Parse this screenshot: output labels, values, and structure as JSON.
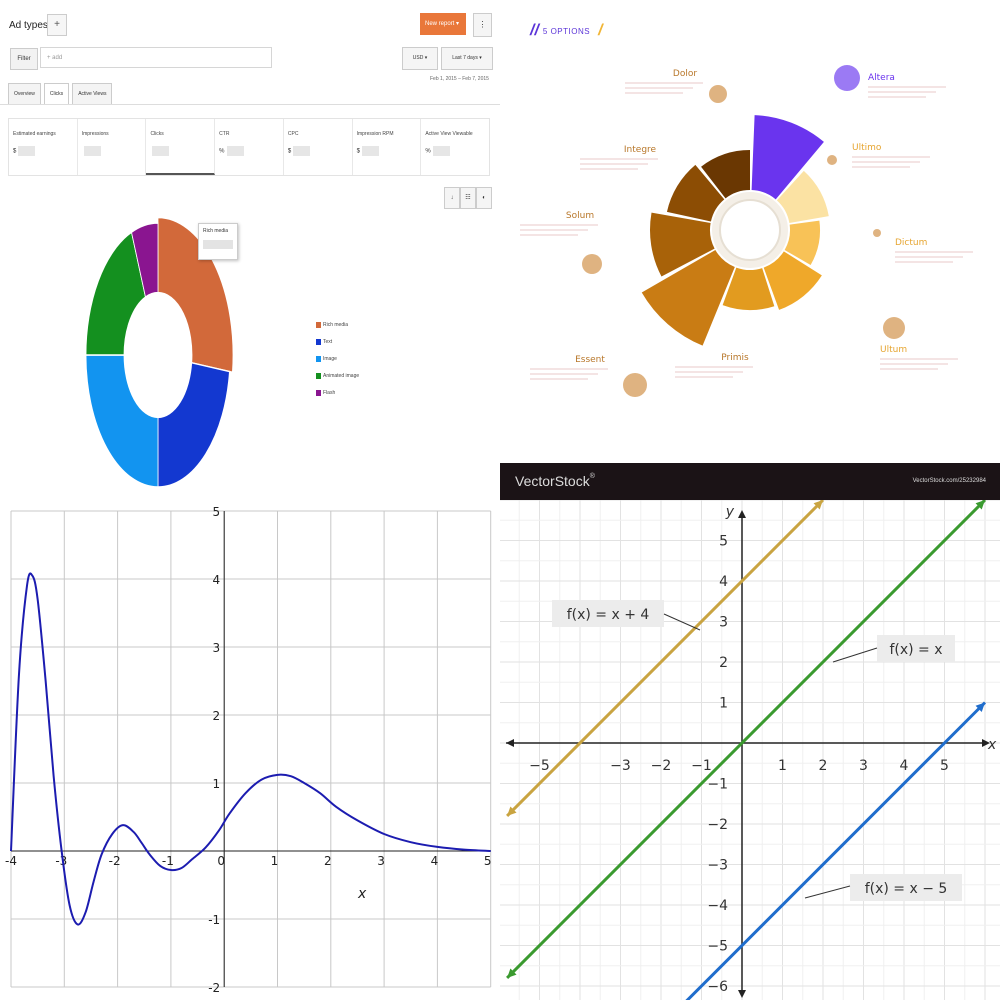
{
  "dashboard": {
    "title": "Ad types",
    "title_arrow": "▾",
    "add_label": "+",
    "new_report_label": "New report ▾",
    "more_label": "⋮",
    "filter_label": "Filter",
    "filter_placeholder": "+ add",
    "currency_label": "USD ▾",
    "range_label": "Last 7 days ▾",
    "date_range": "Feb 1, 2015 – Feb 7, 2015",
    "tabs": [
      {
        "label": "Overview"
      },
      {
        "label": "Clicks"
      },
      {
        "label": "Active Views"
      }
    ],
    "metrics": [
      {
        "label": "Estimated earnings",
        "prefix": "$"
      },
      {
        "label": "Impressions",
        "prefix": ""
      },
      {
        "label": "Clicks",
        "prefix": ""
      },
      {
        "label": "CTR",
        "prefix": "%"
      },
      {
        "label": "CPC",
        "prefix": "$"
      },
      {
        "label": "Impression RPM",
        "prefix": "$"
      },
      {
        "label": "Active View Viewable",
        "prefix": "%"
      }
    ],
    "tooltip_label": "Rich media",
    "view_controls": [
      "↓",
      "☷",
      "◐"
    ]
  },
  "chart_data": [
    {
      "type": "pie",
      "categories": [
        "Rich media",
        "Text",
        "Image",
        "Animated image",
        "Flash"
      ],
      "values": [
        27,
        23,
        25,
        19,
        6
      ],
      "colors": [
        "#d2693a",
        "#1338d0",
        "#1294f0",
        "#14901f",
        "#8a1590"
      ],
      "legend_position": "right"
    },
    {
      "type": "pie",
      "header": "5 OPTIONS",
      "categories": [
        "Altera",
        "Ultimo",
        "Dictum",
        "Ultum",
        "Primis",
        "Essent",
        "Solum",
        "Integre",
        "Dolor"
      ],
      "values": [
        1,
        1,
        1,
        1,
        1,
        1,
        1,
        1,
        1
      ],
      "colors": [
        "#6a34ee",
        "#fbe2a3",
        "#f8c257",
        "#efa82a",
        "#e29b1f",
        "#c97c14",
        "#a86209",
        "#8c4d04",
        "#6a3702"
      ],
      "brand": "VectorStock",
      "brand_mark": "®",
      "url": "VectorStock.com/25232984"
    },
    {
      "type": "line",
      "xlabel": "x",
      "ylabel": "",
      "xlim": [
        -4,
        5
      ],
      "ylim": [
        -2,
        5
      ],
      "grid": true,
      "x_ticks": [
        "-4",
        "-3",
        "-2",
        "-1",
        "0",
        "1",
        "2",
        "3",
        "4",
        "5"
      ],
      "y_ticks": [
        "5",
        "4",
        "3",
        "2",
        "1",
        "-1",
        "-2"
      ],
      "series": [
        {
          "color": "#1c1cb0",
          "x": [
            -4,
            -3.85,
            -3.7,
            -3.6,
            -3.5,
            -3.35,
            -3.2,
            -3.05,
            -2.9,
            -2.75,
            -2.6,
            -2.45,
            -2.3,
            -2.1,
            -1.9,
            -1.7,
            -1.55,
            -1.4,
            -1.2,
            -1.0,
            -0.8,
            -0.6,
            -0.35,
            -0.1,
            0.1,
            0.4,
            0.7,
            1.0,
            1.25,
            1.5,
            1.8,
            2.1,
            2.5,
            3.0,
            3.5,
            4.0,
            4.5,
            5.0
          ],
          "y": [
            0.0,
            2.6,
            3.9,
            4.05,
            3.7,
            2.5,
            1.1,
            0.0,
            -0.8,
            -1.08,
            -0.9,
            -0.45,
            -0.05,
            0.25,
            0.38,
            0.28,
            0.12,
            -0.05,
            -0.22,
            -0.28,
            -0.25,
            -0.12,
            0.05,
            0.3,
            0.55,
            0.85,
            1.05,
            1.12,
            1.1,
            1.0,
            0.85,
            0.65,
            0.45,
            0.25,
            0.13,
            0.06,
            0.02,
            0.0
          ]
        }
      ]
    },
    {
      "type": "line",
      "xlabel": "x",
      "ylabel": "y",
      "xlim": [
        -5.8,
        6
      ],
      "ylim": [
        -6.8,
        6
      ],
      "grid": true,
      "x_ticks": [
        "−5",
        "−3",
        "−2",
        "−1",
        "1",
        "2",
        "3",
        "4",
        "5"
      ],
      "y_ticks": [
        "5",
        "4",
        "3",
        "2",
        "1",
        "−1",
        "−2",
        "−3",
        "−4",
        "−5",
        "−6"
      ],
      "series": [
        {
          "name": "f(x) = x + 4",
          "color": "#c9a441",
          "x": [
            -5.8,
            2
          ],
          "y": [
            -1.8,
            6
          ]
        },
        {
          "name": "f(x) = x",
          "color": "#3a9a2f",
          "x": [
            -5.8,
            6
          ],
          "y": [
            -5.8,
            6
          ]
        },
        {
          "name": "f(x) = x − 5",
          "color": "#1f6dcc",
          "x": [
            -1.8,
            6
          ],
          "y": [
            -6.8,
            1
          ]
        }
      ]
    }
  ]
}
